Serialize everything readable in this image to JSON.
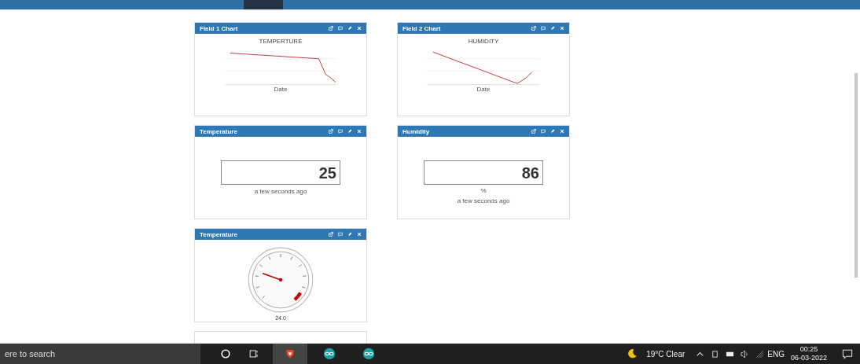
{
  "cards": [
    {
      "kind": "chart",
      "title": "Field 1 Chart",
      "chart_title": "TEMPERTURE",
      "xlabel": "Date"
    },
    {
      "kind": "chart",
      "title": "Field 2 Chart",
      "chart_title": "HUMIDITY",
      "xlabel": "Date"
    },
    {
      "kind": "numeric",
      "title": "Temperature",
      "value": "25",
      "note": "a few seconds ago"
    },
    {
      "kind": "numeric",
      "title": "Humidity",
      "value": "86",
      "unit": "%",
      "note": "a few seconds ago"
    },
    {
      "kind": "gauge",
      "title": "Temperature",
      "reading": "24.0"
    }
  ],
  "taskbar": {
    "search_placeholder": "ere to search",
    "weather": "19°C Clear",
    "language": "ENG",
    "time": "00:25",
    "date": "06-03-2022"
  }
}
